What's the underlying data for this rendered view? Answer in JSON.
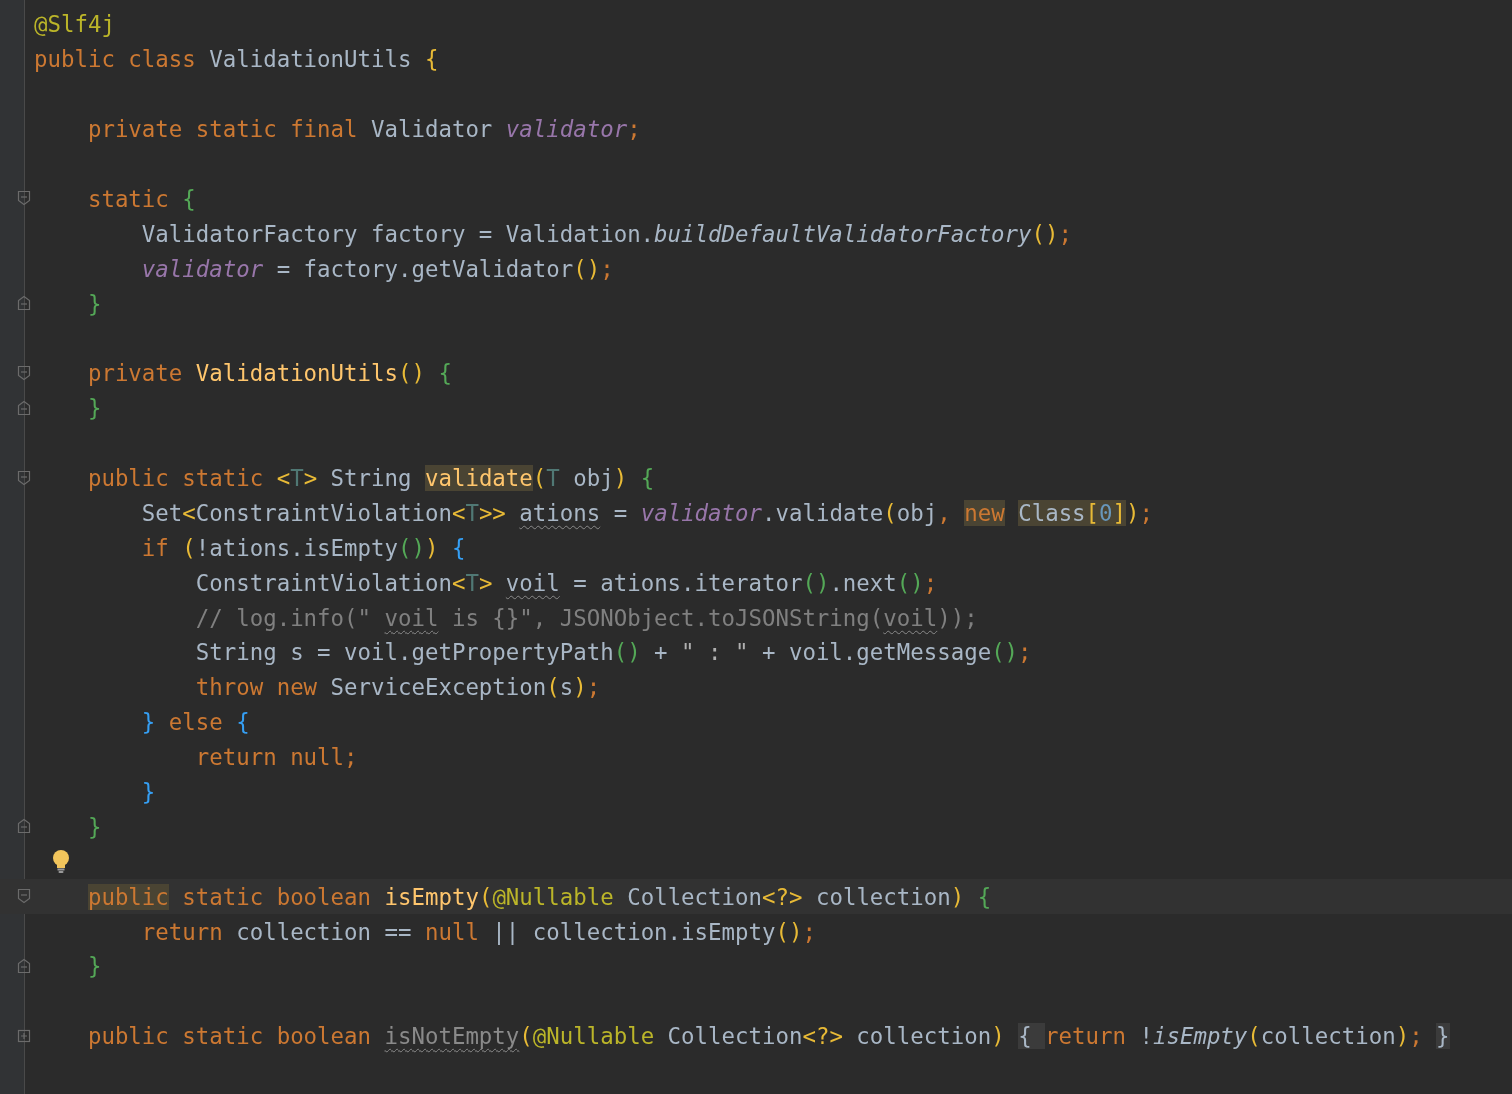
{
  "editor": {
    "lines": [
      {
        "kind": "plain",
        "current": false,
        "tokens": [
          {
            "kind": "ann",
            "text": "@Slf4j"
          }
        ]
      },
      {
        "kind": "plain",
        "current": false,
        "tokens": [
          {
            "kind": "kw",
            "text": "public class "
          },
          {
            "kind": "plain",
            "text": "ValidationUtils "
          },
          {
            "kind": "by",
            "text": "{"
          }
        ]
      },
      {
        "kind": "plain",
        "current": false,
        "space_before": true,
        "tokens": [
          {
            "kind": "kw",
            "text": "    private static final "
          },
          {
            "kind": "plain",
            "text": "Validator "
          },
          {
            "kind": "field",
            "text": "validator"
          },
          {
            "kind": "kw",
            "text": ";"
          }
        ]
      },
      {
        "kind": "fold-start",
        "current": false,
        "space_before": true,
        "tokens": [
          {
            "kind": "kw",
            "text": "    static "
          },
          {
            "kind": "bg",
            "text": "{"
          }
        ]
      },
      {
        "kind": "plain",
        "current": false,
        "tokens": [
          {
            "kind": "plain",
            "text": "        ValidatorFactory factory = Validation."
          },
          {
            "kind": "scall",
            "text": "buildDefaultValidatorFactory"
          },
          {
            "kind": "by",
            "text": "()"
          },
          {
            "kind": "kw",
            "text": ";"
          }
        ]
      },
      {
        "kind": "plain",
        "current": false,
        "tokens": [
          {
            "kind": "field",
            "text": "        validator"
          },
          {
            "kind": "plain",
            "text": " = factory.getValidator"
          },
          {
            "kind": "by",
            "text": "()"
          },
          {
            "kind": "kw",
            "text": ";"
          }
        ]
      },
      {
        "kind": "fold-end",
        "current": false,
        "tokens": [
          {
            "kind": "bg",
            "text": "    }"
          }
        ]
      },
      {
        "kind": "fold-start",
        "current": false,
        "space_before": true,
        "tokens": [
          {
            "kind": "kw",
            "text": "    private "
          },
          {
            "kind": "decl",
            "text": "ValidationUtils"
          },
          {
            "kind": "by",
            "text": "() "
          },
          {
            "kind": "bg",
            "text": "{"
          }
        ]
      },
      {
        "kind": "fold-end",
        "current": false,
        "tokens": [
          {
            "kind": "bg",
            "text": "    }"
          }
        ]
      },
      {
        "kind": "fold-start",
        "current": false,
        "space_before": true,
        "tokens": [
          {
            "kind": "kw",
            "text": "    public static "
          },
          {
            "kind": "by",
            "text": "<"
          },
          {
            "kind": "tp",
            "text": "T"
          },
          {
            "kind": "by",
            "text": ">"
          },
          {
            "kind": "plain",
            "text": " String "
          },
          {
            "kind": "decl",
            "text": "validate",
            "highlighted": true
          },
          {
            "kind": "by",
            "text": "("
          },
          {
            "kind": "tp",
            "text": "T"
          },
          {
            "kind": "plain",
            "text": " obj"
          },
          {
            "kind": "by",
            "text": ") "
          },
          {
            "kind": "bg",
            "text": "{"
          }
        ]
      },
      {
        "kind": "plain",
        "current": false,
        "tokens": [
          {
            "kind": "plain",
            "text": "        Set"
          },
          {
            "kind": "by",
            "text": "<"
          },
          {
            "kind": "plain",
            "text": "ConstraintViolation"
          },
          {
            "kind": "by",
            "text": "<"
          },
          {
            "kind": "tp",
            "text": "T"
          },
          {
            "kind": "by",
            "text": ">> "
          },
          {
            "kind": "plain",
            "text": "ations",
            "warning": true
          },
          {
            "kind": "plain",
            "text": " = "
          },
          {
            "kind": "field",
            "text": "validator"
          },
          {
            "kind": "plain",
            "text": ".validate"
          },
          {
            "kind": "by",
            "text": "("
          },
          {
            "kind": "plain",
            "text": "obj"
          },
          {
            "kind": "kw",
            "text": ", "
          },
          {
            "kind": "kw",
            "text": "new",
            "highlighted": true
          },
          {
            "kind": "plain",
            "text": " Class",
            "highlighted": true
          },
          {
            "kind": "by",
            "text": "[",
            "highlighted": true
          },
          {
            "kind": "num",
            "text": "0",
            "highlighted": true
          },
          {
            "kind": "by",
            "text": "]",
            "highlighted": true
          },
          {
            "kind": "by",
            "text": ")"
          },
          {
            "kind": "kw",
            "text": ";"
          }
        ]
      },
      {
        "kind": "plain",
        "current": false,
        "tokens": [
          {
            "kind": "kw",
            "text": "        if "
          },
          {
            "kind": "by",
            "text": "("
          },
          {
            "kind": "plain",
            "text": "!ations.isEmpty"
          },
          {
            "kind": "bg",
            "text": "()"
          },
          {
            "kind": "by",
            "text": ") "
          },
          {
            "kind": "bb",
            "text": "{"
          }
        ]
      },
      {
        "kind": "plain",
        "current": false,
        "tokens": [
          {
            "kind": "plain",
            "text": "            ConstraintViolation"
          },
          {
            "kind": "by",
            "text": "<"
          },
          {
            "kind": "tp",
            "text": "T"
          },
          {
            "kind": "by",
            "text": "> "
          },
          {
            "kind": "plain",
            "text": "voil",
            "warning": true
          },
          {
            "kind": "plain",
            "text": " = ations.iterator"
          },
          {
            "kind": "bg",
            "text": "()"
          },
          {
            "kind": "plain",
            "text": ".next"
          },
          {
            "kind": "bg",
            "text": "()"
          },
          {
            "kind": "kw",
            "text": ";"
          }
        ]
      },
      {
        "kind": "plain",
        "current": false,
        "tokens": [
          {
            "kind": "comment",
            "text": "            // log.info(\" "
          },
          {
            "kind": "comment",
            "text": "voil",
            "warning": true
          },
          {
            "kind": "comment",
            "text": " is {}\", JSONObject.toJSONString("
          },
          {
            "kind": "comment",
            "text": "voil",
            "warning": true
          },
          {
            "kind": "comment",
            "text": "));"
          }
        ]
      },
      {
        "kind": "plain",
        "current": false,
        "tokens": [
          {
            "kind": "plain",
            "text": "            String s = voil.getPropertyPath"
          },
          {
            "kind": "bg",
            "text": "()"
          },
          {
            "kind": "plain",
            "text": " + "
          },
          {
            "kind": "str",
            "text": "\" : \""
          },
          {
            "kind": "plain",
            "text": " + voil.getMessage"
          },
          {
            "kind": "bg",
            "text": "()"
          },
          {
            "kind": "kw",
            "text": ";"
          }
        ]
      },
      {
        "kind": "plain",
        "current": false,
        "tokens": [
          {
            "kind": "kw",
            "text": "            throw new "
          },
          {
            "kind": "plain",
            "text": "ServiceException"
          },
          {
            "kind": "by",
            "text": "("
          },
          {
            "kind": "plain",
            "text": "s"
          },
          {
            "kind": "by",
            "text": ")"
          },
          {
            "kind": "kw",
            "text": ";"
          }
        ]
      },
      {
        "kind": "plain",
        "current": false,
        "tokens": [
          {
            "kind": "bb",
            "text": "        } "
          },
          {
            "kind": "kw",
            "text": "else "
          },
          {
            "kind": "bb",
            "text": "{"
          }
        ]
      },
      {
        "kind": "plain",
        "current": false,
        "tokens": [
          {
            "kind": "kw",
            "text": "            return null;"
          }
        ]
      },
      {
        "kind": "plain",
        "current": false,
        "tokens": [
          {
            "kind": "bb",
            "text": "        }"
          }
        ]
      },
      {
        "kind": "fold-end",
        "current": false,
        "tokens": [
          {
            "kind": "bg",
            "text": "    }"
          }
        ]
      },
      {
        "kind": "bulb",
        "current": false
      },
      {
        "kind": "fold-start",
        "current": true,
        "tokens": [
          {
            "kind": "kw",
            "text": "    public",
            "highlighted": true
          },
          {
            "kind": "kw",
            "text": " static boolean "
          },
          {
            "kind": "decl",
            "text": "isEmpty"
          },
          {
            "kind": "by",
            "text": "("
          },
          {
            "kind": "ann",
            "text": "@Nullable"
          },
          {
            "kind": "plain",
            "text": " Collection"
          },
          {
            "kind": "by",
            "text": "<?>"
          },
          {
            "kind": "plain",
            "text": " collection"
          },
          {
            "kind": "by",
            "text": ") "
          },
          {
            "kind": "bg",
            "text": "{"
          }
        ]
      },
      {
        "kind": "plain",
        "current": false,
        "tokens": [
          {
            "kind": "kw",
            "text": "        return "
          },
          {
            "kind": "plain",
            "text": "collection == "
          },
          {
            "kind": "kw",
            "text": "null "
          },
          {
            "kind": "plain",
            "text": "|| collection.isEmpty"
          },
          {
            "kind": "by",
            "text": "()"
          },
          {
            "kind": "kw",
            "text": ";"
          }
        ]
      },
      {
        "kind": "fold-end",
        "current": false,
        "tokens": [
          {
            "kind": "bg",
            "text": "    }"
          }
        ]
      },
      {
        "kind": "collapsed",
        "current": false,
        "space_before": true,
        "tokens": [
          {
            "kind": "kw",
            "text": "    public static boolean "
          },
          {
            "kind": "dim",
            "text": "isNotEmpty",
            "warning": true
          },
          {
            "kind": "by",
            "text": "("
          },
          {
            "kind": "ann",
            "text": "@Nullable"
          },
          {
            "kind": "plain",
            "text": " Collection"
          },
          {
            "kind": "by",
            "text": "<?>"
          },
          {
            "kind": "plain",
            "text": " collection"
          },
          {
            "kind": "by",
            "text": ") "
          },
          {
            "kind": "folded",
            "text": "{ "
          },
          {
            "kind": "kw",
            "text": "return "
          },
          {
            "kind": "plain",
            "text": "!"
          },
          {
            "kind": "scall",
            "text": "isEmpty"
          },
          {
            "kind": "by",
            "text": "("
          },
          {
            "kind": "plain",
            "text": "collection"
          },
          {
            "kind": "by",
            "text": ")"
          },
          {
            "kind": "kw",
            "text": "; "
          },
          {
            "kind": "folded",
            "text": "}"
          }
        ]
      }
    ]
  }
}
